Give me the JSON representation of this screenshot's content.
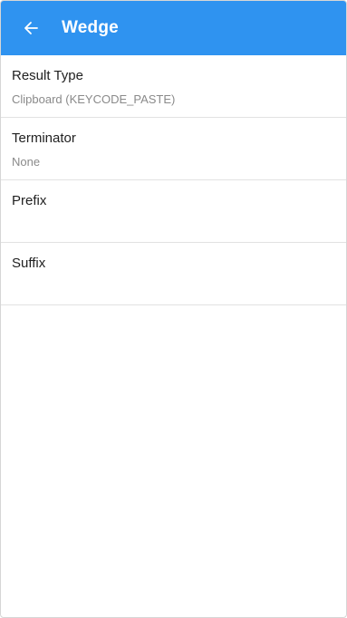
{
  "colors": {
    "appbar": "#2f93f0",
    "appbar_text": "#ffffff",
    "title_text": "#212121",
    "summary_text": "#8a8a8a",
    "divider": "#e2e2e2"
  },
  "appbar": {
    "back_icon": "arrow-left-icon",
    "title": "Wedge"
  },
  "preferences": [
    {
      "title": "Result Type",
      "summary": "Clipboard (KEYCODE_PASTE)"
    },
    {
      "title": "Terminator",
      "summary": "None"
    },
    {
      "title": "Prefix",
      "summary": ""
    },
    {
      "title": "Suffix",
      "summary": ""
    }
  ]
}
